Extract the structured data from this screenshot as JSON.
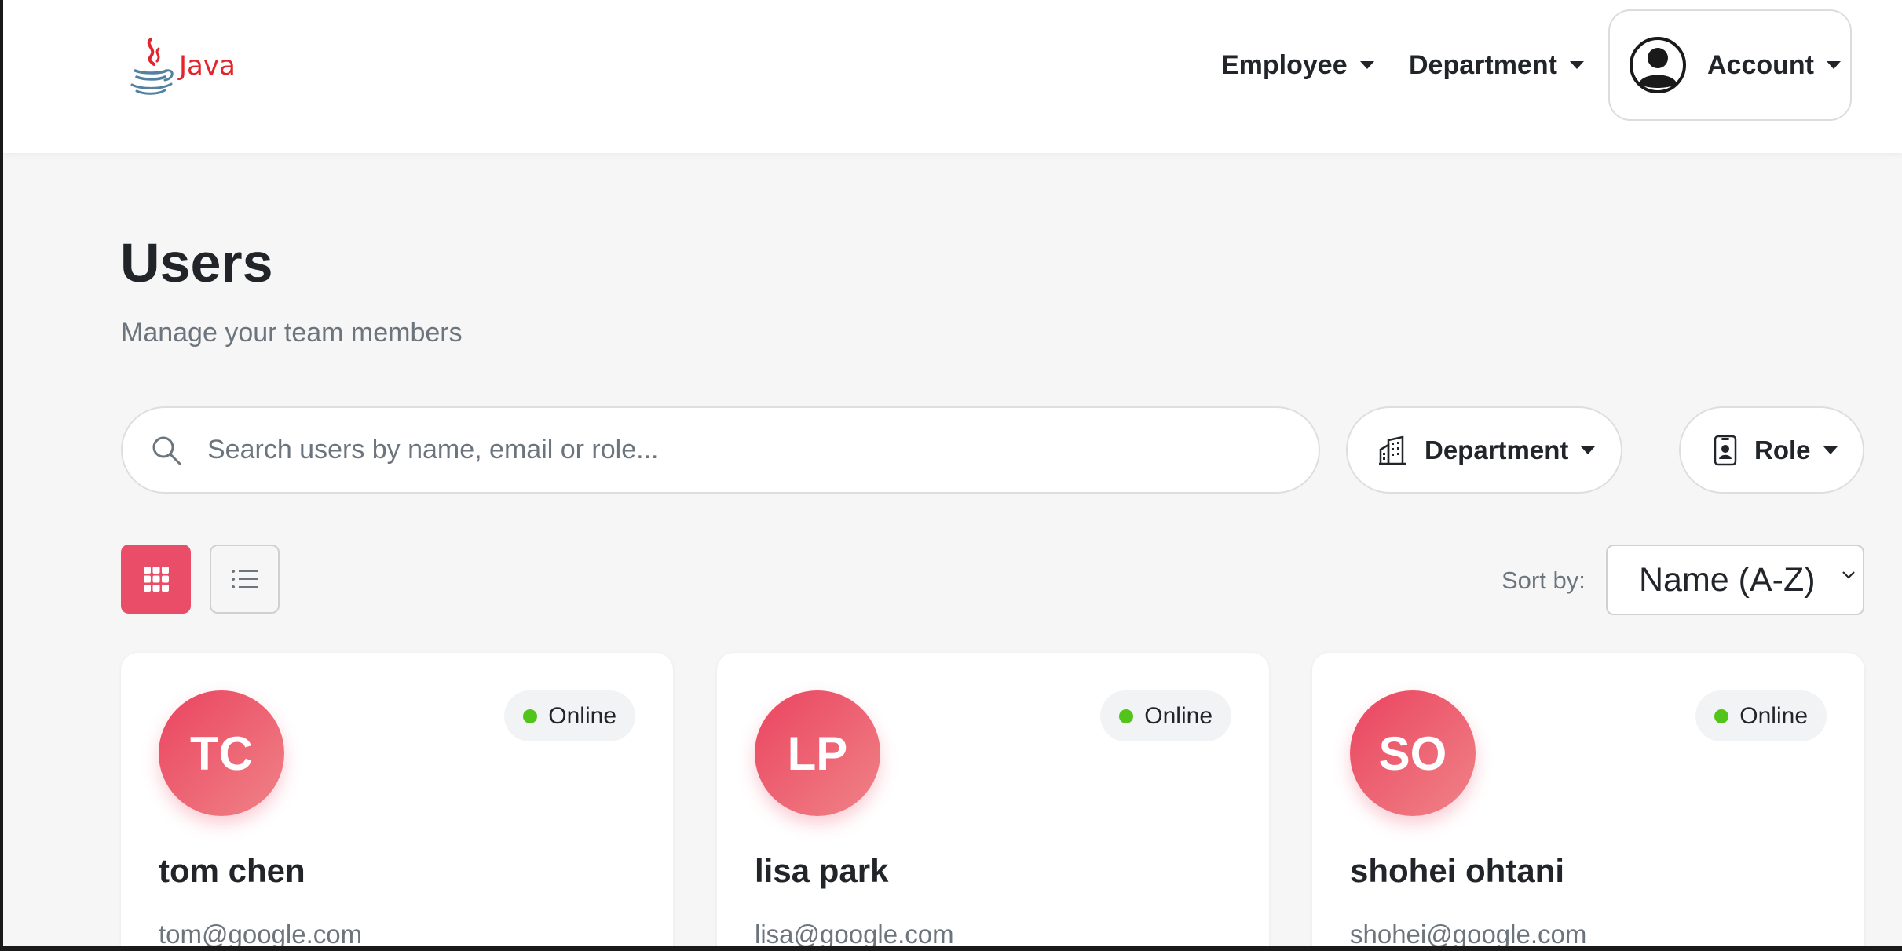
{
  "brand": {
    "name": "Java",
    "logo_icon": "java-coffee-cup-icon"
  },
  "nav": {
    "items": [
      {
        "label": "Employee"
      },
      {
        "label": "Department"
      }
    ],
    "account": {
      "label": "Account",
      "icon": "user-circle-icon"
    }
  },
  "page": {
    "title": "Users",
    "subtitle": "Manage your team members"
  },
  "search": {
    "placeholder": "Search users by name, email or role...",
    "value": ""
  },
  "filters": {
    "department": {
      "label": "Department",
      "icon": "building-icon"
    },
    "role": {
      "label": "Role",
      "icon": "id-badge-icon"
    }
  },
  "view": {
    "active": "grid",
    "options": [
      "grid",
      "list"
    ]
  },
  "sort": {
    "label": "Sort by:",
    "selected": "Name (A-Z)"
  },
  "colors": {
    "accent": "#e94d67",
    "online": "#52c41a",
    "brand_red": "#e2242c",
    "brand_blue": "#5382a1"
  },
  "users": [
    {
      "initials": "TC",
      "name": "tom chen",
      "email": "tom@google.com",
      "status": "Online"
    },
    {
      "initials": "LP",
      "name": "lisa park",
      "email": "lisa@google.com",
      "status": "Online"
    },
    {
      "initials": "SO",
      "name": "shohei ohtani",
      "email": "shohei@google.com",
      "status": "Online"
    }
  ]
}
